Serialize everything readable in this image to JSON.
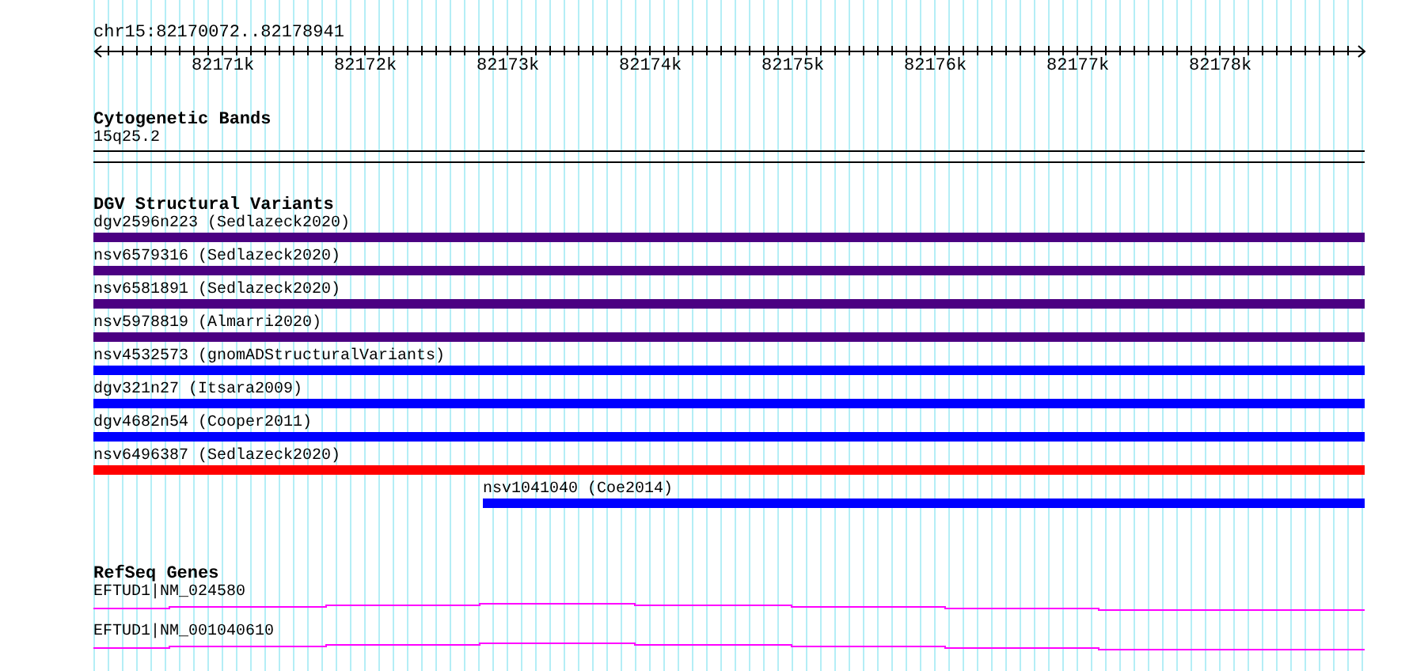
{
  "ruler": {
    "region": "chr15:82170072..82178941",
    "ticks": [
      "82171k",
      "82172k",
      "82173k",
      "82174k",
      "82175k",
      "82176k",
      "82177k",
      "82178k"
    ]
  },
  "cytogenetic_bands": {
    "title": "Cytogenetic Bands",
    "band": "15q25.2"
  },
  "dgv_structural_variants": {
    "title": "DGV Structural Variants",
    "features": [
      {
        "label": "dgv2596n223 (Sedlazeck2020)",
        "color": "#4b0082",
        "kind": "full"
      },
      {
        "label": "nsv6579316 (Sedlazeck2020)",
        "color": "#4b0082",
        "kind": "full"
      },
      {
        "label": "nsv6581891 (Sedlazeck2020)",
        "color": "#4b0082",
        "kind": "full"
      },
      {
        "label": "nsv5978819 (Almarri2020)",
        "color": "#4b0082",
        "kind": "full"
      },
      {
        "label": "nsv4532573 (gnomADStructuralVariants)",
        "color": "#0000ff",
        "kind": "full"
      },
      {
        "label": "dgv321n27 (Itsara2009)",
        "color": "#0000ff",
        "kind": "full"
      },
      {
        "label": "dgv4682n54 (Cooper2011)",
        "color": "#0000ff",
        "kind": "full"
      },
      {
        "label": "nsv6496387 (Sedlazeck2020)",
        "color": "#ff0000",
        "kind": "full"
      },
      {
        "label": "nsv1041040 (Coe2014)",
        "color": "#0000ff",
        "kind": "partial"
      }
    ]
  },
  "refseq_genes": {
    "title": "RefSeq Genes",
    "transcripts": [
      {
        "label": "EFTUD1|NM_024580"
      },
      {
        "label": "EFTUD1|NM_001040610"
      }
    ]
  }
}
